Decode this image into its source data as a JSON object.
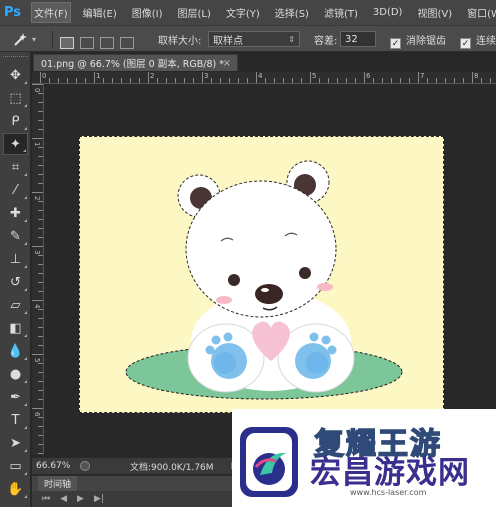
{
  "app": {
    "logo_text": "Ps"
  },
  "menu": [
    {
      "label": "文件(F)",
      "active": true
    },
    {
      "label": "编辑(E)"
    },
    {
      "label": "图像(I)"
    },
    {
      "label": "图层(L)"
    },
    {
      "label": "文字(Y)"
    },
    {
      "label": "选择(S)"
    },
    {
      "label": "滤镜(T)"
    },
    {
      "label": "3D(D)"
    },
    {
      "label": "视图(V)"
    },
    {
      "label": "窗口(W)"
    }
  ],
  "options_bar": {
    "tool_icon": "magic-wand-icon",
    "sample_size_label": "取样大小:",
    "sample_size_value": "取样点",
    "tolerance_label": "容差:",
    "tolerance_value": "32",
    "anti_alias_label": "消除锯齿",
    "anti_alias_checked": true,
    "contiguous_label": "连续",
    "contiguous_checked": true
  },
  "tools": [
    "move-icon",
    "marquee-icon",
    "lasso-icon",
    "magic-wand-icon",
    "crop-icon",
    "eyedropper-icon",
    "healing-brush-icon",
    "brush-icon",
    "clone-stamp-icon",
    "history-brush-icon",
    "eraser-icon",
    "paint-bucket-icon",
    "blur-icon",
    "dodge-icon",
    "pen-icon",
    "type-icon",
    "path-selection-icon",
    "rectangle-icon",
    "hand-icon"
  ],
  "document": {
    "tab_title": "01.png @ 66.7% (图层 0 副本, RGB/8) *",
    "canvas_color": "#fdf7c4"
  },
  "ruler": {
    "h_labels": [
      "0",
      "",
      "1",
      "",
      "2",
      "",
      "3",
      "",
      "4",
      "",
      "5",
      "",
      "6",
      "",
      "7",
      "",
      "8"
    ],
    "v_labels": [
      "0",
      "1",
      "2",
      "3",
      "4",
      "5",
      "6",
      "7"
    ]
  },
  "status": {
    "zoom": "66.67%",
    "doc_info": "文档:900.0K/1.76M"
  },
  "timeline": {
    "tab_label": "时间轴"
  },
  "watermark": {
    "top_text": "复耀王游",
    "main_text": "宏昌游戏网",
    "url": "www.hcs-laser.com"
  }
}
